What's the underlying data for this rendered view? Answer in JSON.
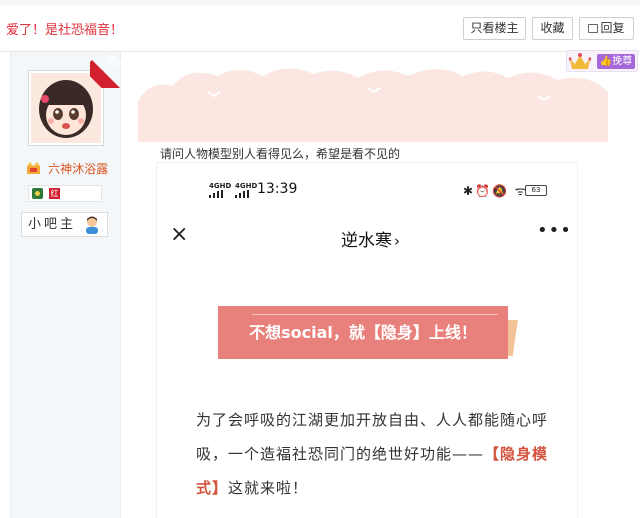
{
  "header": {
    "thread_title": "爱了！是社恐福音！",
    "btn_only_lz": "只看楼主",
    "btn_favorite": "收藏",
    "btn_reply": "回复"
  },
  "top_badge": {
    "pill_text": "挽尊"
  },
  "author": {
    "lz_ribbon": "楼主",
    "name": "六神沐浴露",
    "level_badge": "红",
    "role": "小吧主"
  },
  "post": {
    "text": "请问人物模型别人看得见么，希望是看不见的"
  },
  "screenshot": {
    "net1": "4GHD",
    "net2": "4GHD",
    "time": "13:39",
    "status_icons": "✱⏰🔕 ᯤ",
    "battery": "63",
    "nav_title": "逆水寒",
    "nav_chevron": "›",
    "nav_close": "×",
    "nav_more": "•••",
    "banner": "不想social，就【隐身】上线！",
    "article_1": "为了会呼吸的江湖更加开放自由、人人都能随心呼吸，一个造福社恐同门的绝世好功能——",
    "article_hl": "【隐身模式】",
    "article_2": "这就来啦！"
  },
  "colors": {
    "title_red": "#e0303a",
    "username_orange": "#d9541e",
    "banner_pink": "#e8807b",
    "highlight": "#d35540",
    "badge_purple": "#a667d9"
  }
}
